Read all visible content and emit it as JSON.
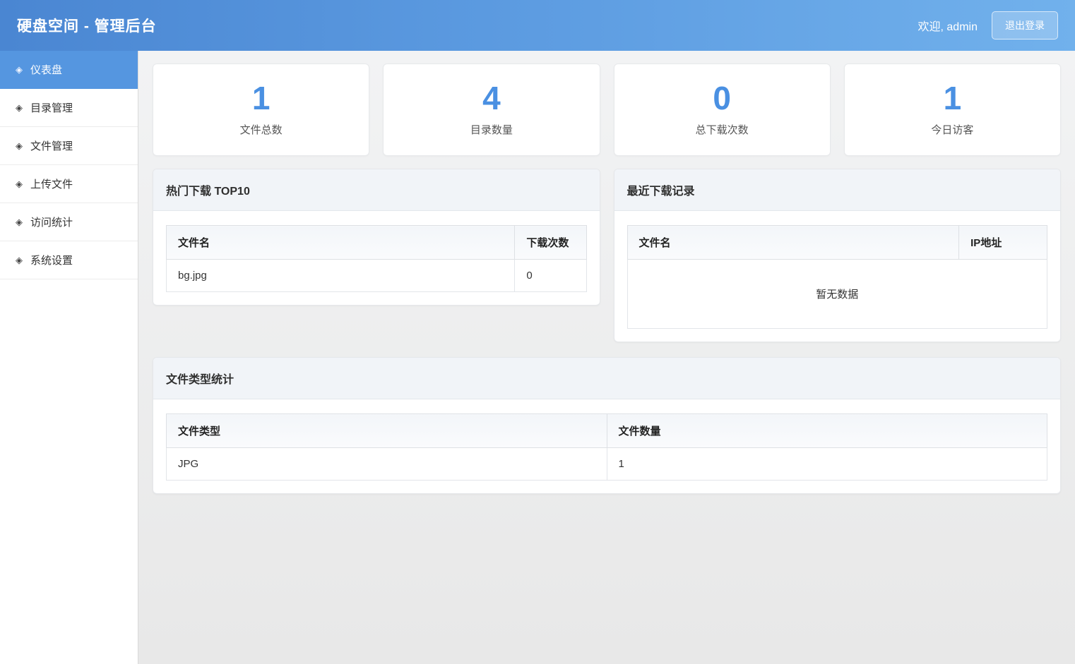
{
  "header": {
    "title": "硬盘空间 - 管理后台",
    "welcome": "欢迎, admin",
    "logout_label": "退出登录"
  },
  "sidebar": {
    "items": [
      {
        "icon": "◈",
        "label": "仪表盘",
        "active": true
      },
      {
        "icon": "◈",
        "label": "目录管理",
        "active": false
      },
      {
        "icon": "◈",
        "label": "文件管理",
        "active": false
      },
      {
        "icon": "◈",
        "label": "上传文件",
        "active": false
      },
      {
        "icon": "◈",
        "label": "访问统计",
        "active": false
      },
      {
        "icon": "◈",
        "label": "系统设置",
        "active": false
      }
    ]
  },
  "stats": [
    {
      "value": "1",
      "label": "文件总数"
    },
    {
      "value": "4",
      "label": "目录数量"
    },
    {
      "value": "0",
      "label": "总下载次数"
    },
    {
      "value": "1",
      "label": "今日访客"
    }
  ],
  "panels": {
    "hot_downloads": {
      "title": "热门下载 TOP10",
      "columns": [
        "文件名",
        "下载次数"
      ],
      "rows": [
        [
          "bg.jpg",
          "0"
        ]
      ]
    },
    "recent_downloads": {
      "title": "最近下载记录",
      "columns": [
        "文件名",
        "IP地址"
      ],
      "empty_text": "暂无数据"
    },
    "file_types": {
      "title": "文件类型统计",
      "columns": [
        "文件类型",
        "文件数量"
      ],
      "rows": [
        [
          "JPG",
          "1"
        ]
      ]
    }
  },
  "colors": {
    "accent_blue": "#4a90e2",
    "sidebar_active": "#5596e0",
    "header_gradient_left": "#4a86d2",
    "header_gradient_right": "#71b1ec",
    "empty_text_gray": "#a8a8a8"
  }
}
